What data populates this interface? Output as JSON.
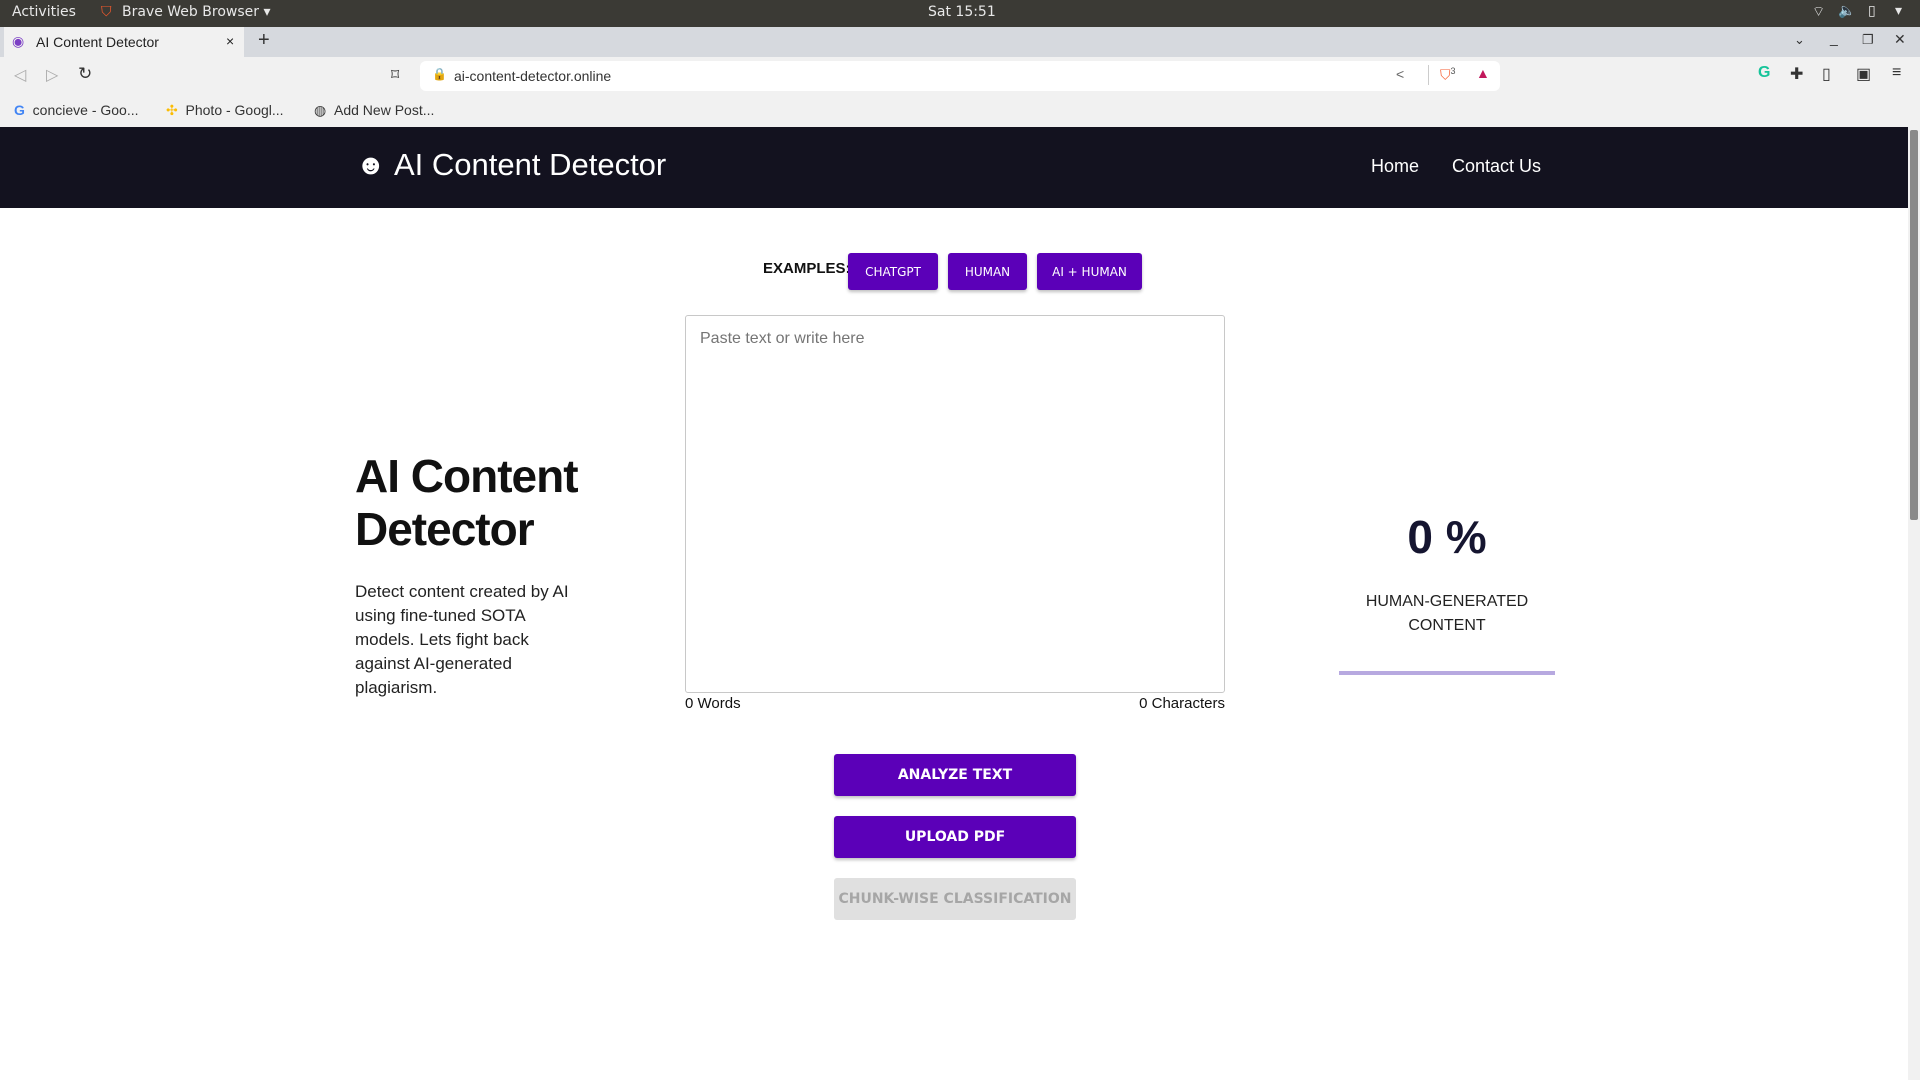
{
  "os": {
    "activities": "Activities",
    "app": "Brave Web Browser",
    "clock": "Sat 15:51"
  },
  "browser": {
    "tab_title": "AI Content Detector",
    "new_tab": "+",
    "url": "ai-content-detector.online",
    "shield_count": "3",
    "bookmarks": [
      {
        "label": "concieve - Goo...",
        "icon": "google-icon"
      },
      {
        "label": "Photo - Googl...",
        "icon": "google-photos-icon"
      },
      {
        "label": "Add New Post...",
        "icon": "wordpress-icon"
      }
    ]
  },
  "header": {
    "title": "AI Content Detector",
    "nav": [
      "Home",
      "Contact Us"
    ]
  },
  "intro": {
    "heading": "AI Content Detector",
    "description": "Detect content created by AI using fine-tuned SOTA models. Lets fight back against AI-generated plagiarism."
  },
  "examples": {
    "label": "EXAMPLES:",
    "buttons": [
      "CHATGPT",
      "HUMAN",
      "AI + HUMAN"
    ]
  },
  "editor": {
    "placeholder": "Paste text or write here",
    "value": "",
    "words": "0 Words",
    "characters": "0 Characters"
  },
  "actions": {
    "analyze": "ANALYZE TEXT",
    "upload": "UPLOAD PDF",
    "chunk": "CHUNK-WISE CLASSIFICATION"
  },
  "result": {
    "percent": "0 %",
    "label": "HUMAN-GENERATED CONTENT",
    "progress": 0
  },
  "colors": {
    "accent": "#5b00b8",
    "header_bg": "#13121f",
    "bar": "#b7a9e0"
  }
}
